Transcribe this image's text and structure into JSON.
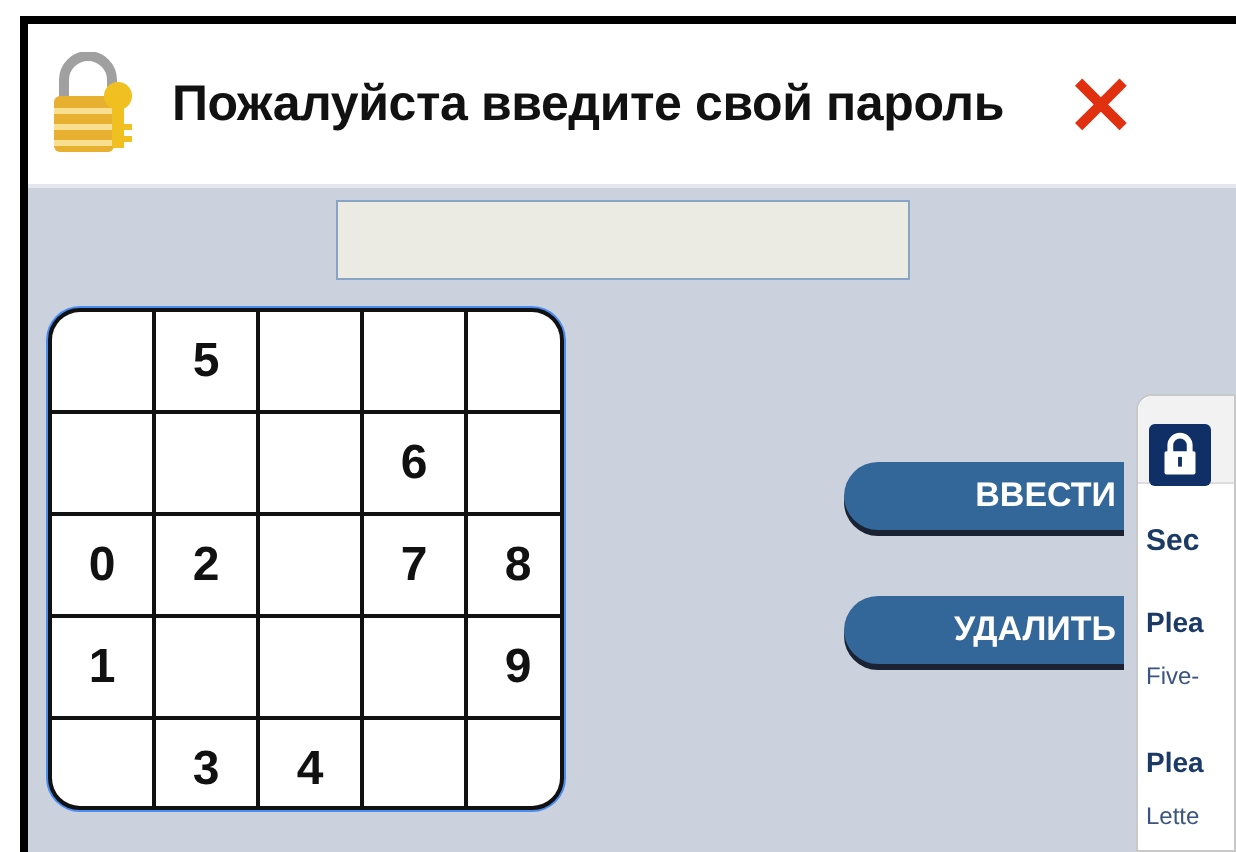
{
  "dialog": {
    "title": "Пожалуйста введите свой пароль",
    "close": "×"
  },
  "keypad": {
    "rows": [
      [
        {},
        {
          "digit": "5"
        },
        {},
        {},
        {}
      ],
      [
        {},
        {},
        {},
        {
          "digit": "6"
        },
        {}
      ],
      [
        {
          "digit": "0"
        },
        {
          "digit": "2"
        },
        {},
        {
          "digit": "7"
        },
        {
          "digit": "8"
        }
      ],
      [
        {
          "digit": "1"
        },
        {},
        {},
        {},
        {
          "digit": "9"
        }
      ],
      [
        {},
        {
          "digit": "3"
        },
        {
          "digit": "4"
        },
        {},
        {}
      ]
    ]
  },
  "buttons": [
    {
      "label": "ВВЕСТИ"
    },
    {
      "label": "УДАЛИТЬ"
    }
  ],
  "side_panel": {
    "lines": [
      {
        "kind": "heading",
        "text": "Sec"
      },
      {
        "kind": "label",
        "text": "Plea"
      },
      {
        "kind": "hint",
        "text": "Five-"
      },
      {
        "kind": "label",
        "text": "Plea"
      },
      {
        "kind": "hint",
        "text": "Lette"
      }
    ]
  }
}
